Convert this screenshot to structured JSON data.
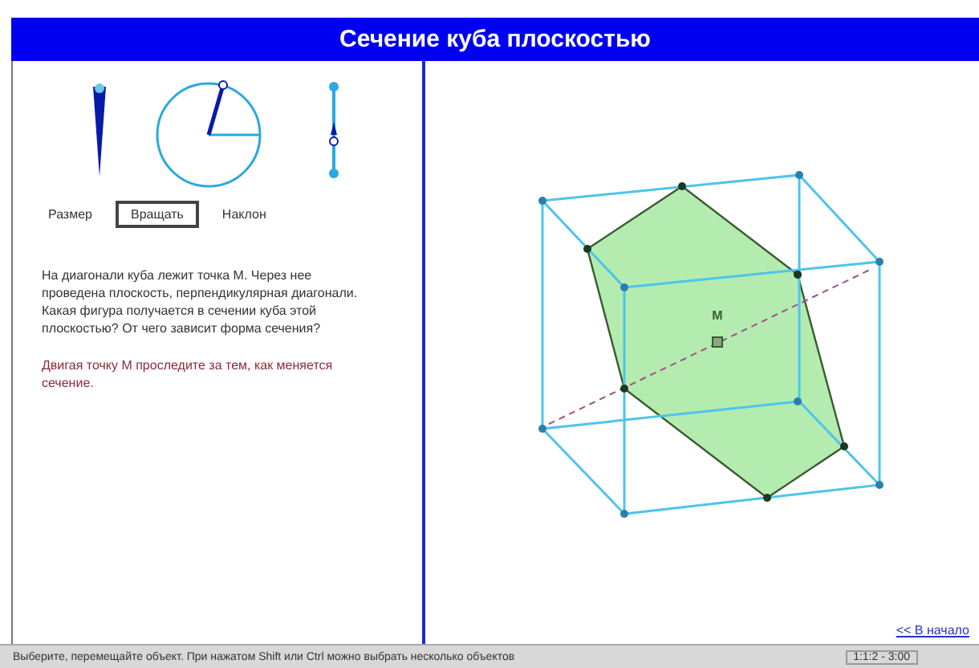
{
  "title": "Сечение куба плоскостью",
  "controls": [
    {
      "kind": "label",
      "label": "Размер"
    },
    {
      "kind": "button",
      "label": "Вращать"
    },
    {
      "kind": "label",
      "label": "Наклон"
    }
  ],
  "paragraphs": [
    {
      "kind": "question",
      "text": "На диагонали куба лежит точка M. Через нее проведена плоскость, перпендикулярная диагонали. Какая фигура получается в сечении куба этой плоскостью? От чего зависит форма сечения?"
    },
    {
      "kind": "task",
      "text": "Двигая точку M проследите за тем, как меняется сечение."
    }
  ],
  "point_label": "M",
  "link": "<< В начало",
  "status_bar": {
    "message": "Выберите, перемещайте объект. При нажатом Shift или Ctrl можно выбрать несколько объектов",
    "position": "1:1:2 - 3:00"
  }
}
